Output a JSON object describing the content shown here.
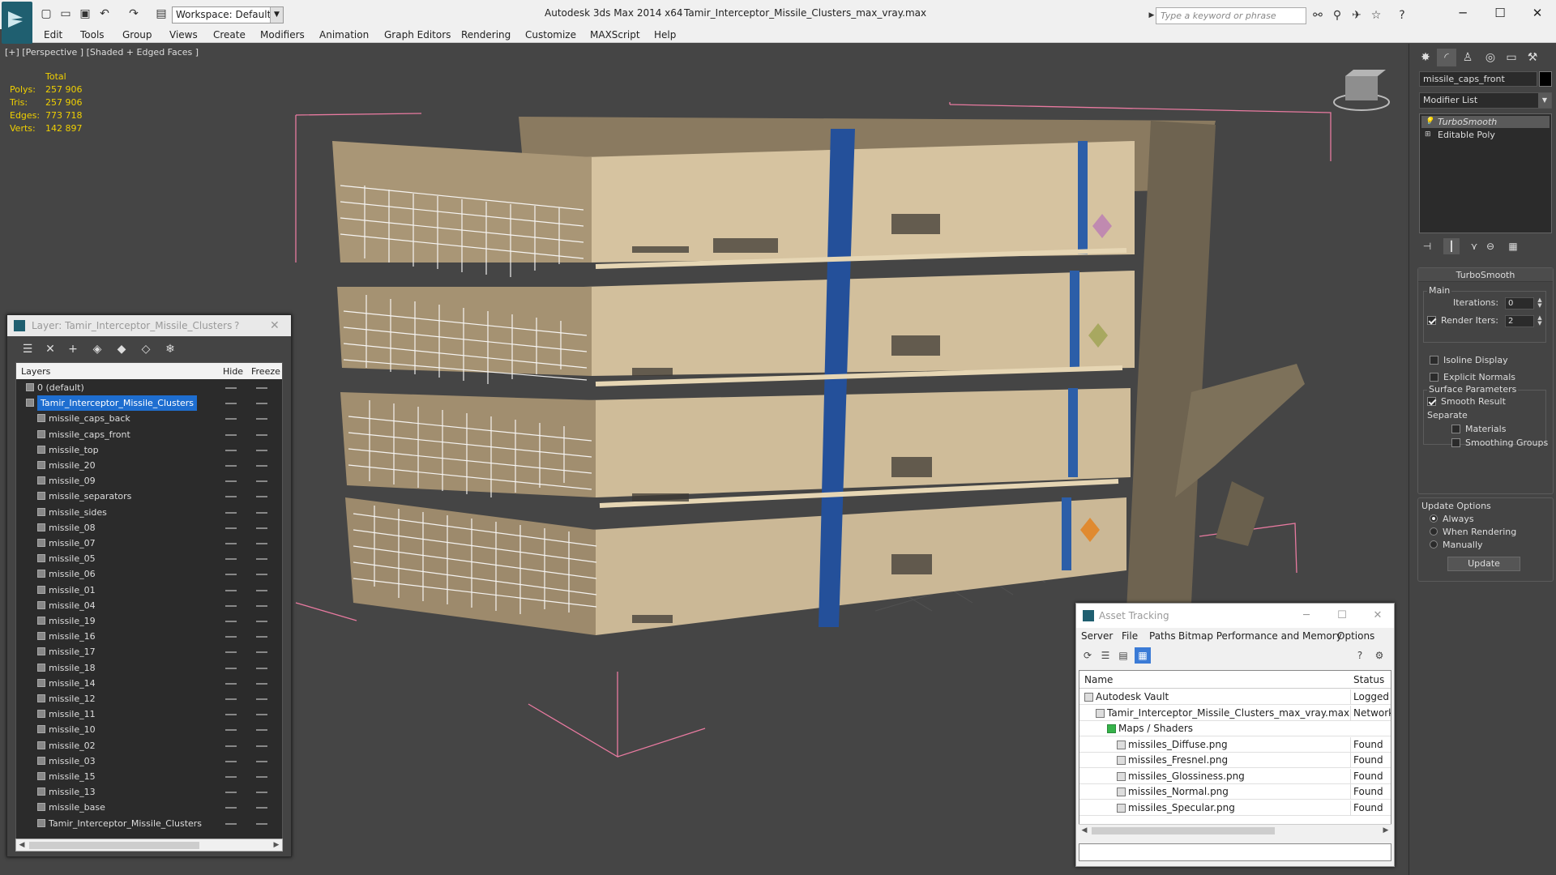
{
  "titlebar": {
    "app_title": "Autodesk 3ds Max  2014 x64",
    "file_title": "Tamir_Interceptor_Missile_Clusters_max_vray.max",
    "workspace": "Workspace: Default",
    "search_placeholder": "Type a keyword or phrase"
  },
  "menu": [
    "Edit",
    "Tools",
    "Group",
    "Views",
    "Create",
    "Modifiers",
    "Animation",
    "Graph Editors",
    "Rendering",
    "Customize",
    "MAXScript",
    "Help"
  ],
  "viewport": {
    "label": "[+] [Perspective ] [Shaded + Edged Faces ]",
    "stats": {
      "total_label": "Total",
      "rows": [
        {
          "k": "Polys:",
          "v": "257 906"
        },
        {
          "k": "Tris:",
          "v": "257 906"
        },
        {
          "k": "Edges:",
          "v": "773 718"
        },
        {
          "k": "Verts:",
          "v": "142 897"
        }
      ]
    }
  },
  "command_panel": {
    "object_name": "missile_caps_front",
    "modifier_list": "Modifier List",
    "stack": [
      "TurboSmooth",
      "Editable Poly"
    ],
    "turbosmooth": {
      "title": "TurboSmooth",
      "main": "Main",
      "iterations_label": "Iterations:",
      "iterations_value": "0",
      "render_iters_label": "Render Iters:",
      "render_iters_value": "2",
      "isoline": "Isoline Display",
      "explicit_normals": "Explicit Normals",
      "surface_params": "Surface Parameters",
      "smooth_result": "Smooth Result",
      "separate": "Separate",
      "materials": "Materials",
      "smoothing_groups": "Smoothing Groups",
      "update_options": "Update Options",
      "always": "Always",
      "when_rendering": "When Rendering",
      "manually": "Manually",
      "update_btn": "Update"
    }
  },
  "layer_window": {
    "title": "Layer: Tamir_Interceptor_Missile_Clusters",
    "help": "?",
    "columns": {
      "layers": "Layers",
      "hide": "Hide",
      "freeze": "Freeze"
    },
    "rows": [
      "0 (default)",
      "Tamir_Interceptor_Missile_Clusters",
      "missile_caps_back",
      "missile_caps_front",
      "missile_top",
      "missile_20",
      "missile_09",
      "missile_separators",
      "missile_sides",
      "missile_08",
      "missile_07",
      "missile_05",
      "missile_06",
      "missile_01",
      "missile_04",
      "missile_19",
      "missile_16",
      "missile_17",
      "missile_18",
      "missile_14",
      "missile_12",
      "missile_11",
      "missile_10",
      "missile_02",
      "missile_03",
      "missile_15",
      "missile_13",
      "missile_base",
      "Tamir_Interceptor_Missile_Clusters"
    ]
  },
  "asset_window": {
    "title": "Asset Tracking",
    "menu": [
      "Server",
      "File",
      "Paths",
      "Bitmap Performance and Memory",
      "Options"
    ],
    "columns": {
      "name": "Name",
      "status": "Status"
    },
    "rows": [
      {
        "name": "Autodesk Vault",
        "status": "Logged Out"
      },
      {
        "name": "Tamir_Interceptor_Missile_Clusters_max_vray.max",
        "status": "Network"
      },
      {
        "name": "Maps / Shaders",
        "status": ""
      },
      {
        "name": "missiles_Diffuse.png",
        "status": "Found"
      },
      {
        "name": "missiles_Fresnel.png",
        "status": "Found"
      },
      {
        "name": "missiles_Glossiness.png",
        "status": "Found"
      },
      {
        "name": "missiles_Normal.png",
        "status": "Found"
      },
      {
        "name": "missiles_Specular.png",
        "status": "Found"
      }
    ]
  }
}
